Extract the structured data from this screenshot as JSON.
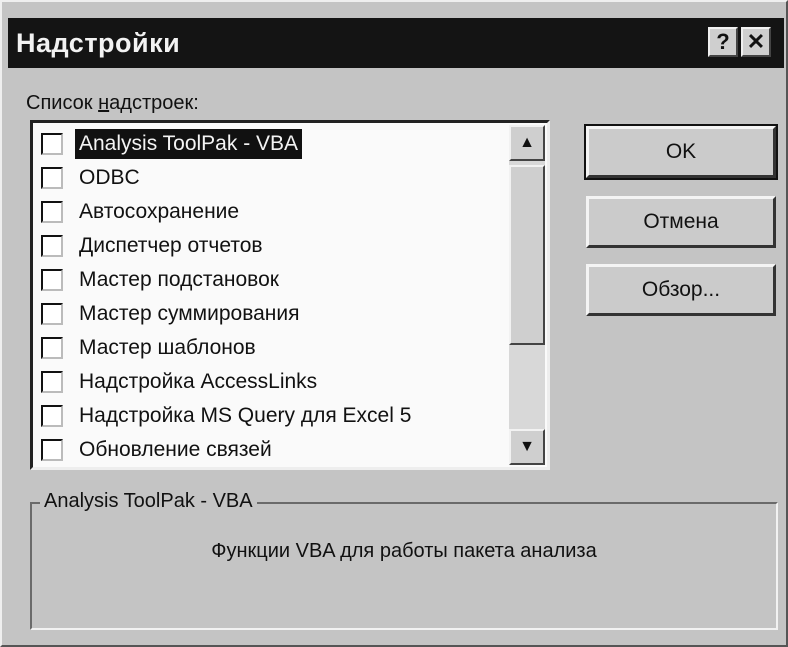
{
  "window": {
    "title": "Надстройки",
    "help_symbol": "?",
    "close_symbol": "✕"
  },
  "addins": {
    "label_prefix": "Список ",
    "label_accel": "н",
    "label_suffix": "адстроек:",
    "items": [
      {
        "label": "Analysis ToolPak - VBA",
        "checked": false,
        "selected": true
      },
      {
        "label": "ODBC",
        "checked": false,
        "selected": false
      },
      {
        "label": "Автосохранение",
        "checked": false,
        "selected": false
      },
      {
        "label": "Диспетчер отчетов",
        "checked": false,
        "selected": false
      },
      {
        "label": "Мастер подстановок",
        "checked": false,
        "selected": false
      },
      {
        "label": "Мастер суммирования",
        "checked": false,
        "selected": false
      },
      {
        "label": "Мастер шаблонов",
        "checked": false,
        "selected": false
      },
      {
        "label": "Надстройка AccessLinks",
        "checked": false,
        "selected": false
      },
      {
        "label": "Надстройка MS Query для Excel 5",
        "checked": false,
        "selected": false
      },
      {
        "label": "Обновление связей",
        "checked": false,
        "selected": false
      }
    ],
    "scroll_up_symbol": "▲",
    "scroll_down_symbol": "▼"
  },
  "buttons": {
    "ok": "OK",
    "cancel": "Отмена",
    "browse": "Обзор..."
  },
  "description": {
    "title": "Analysis ToolPak - VBA",
    "text": "Функции VBA для работы пакета анализа"
  }
}
